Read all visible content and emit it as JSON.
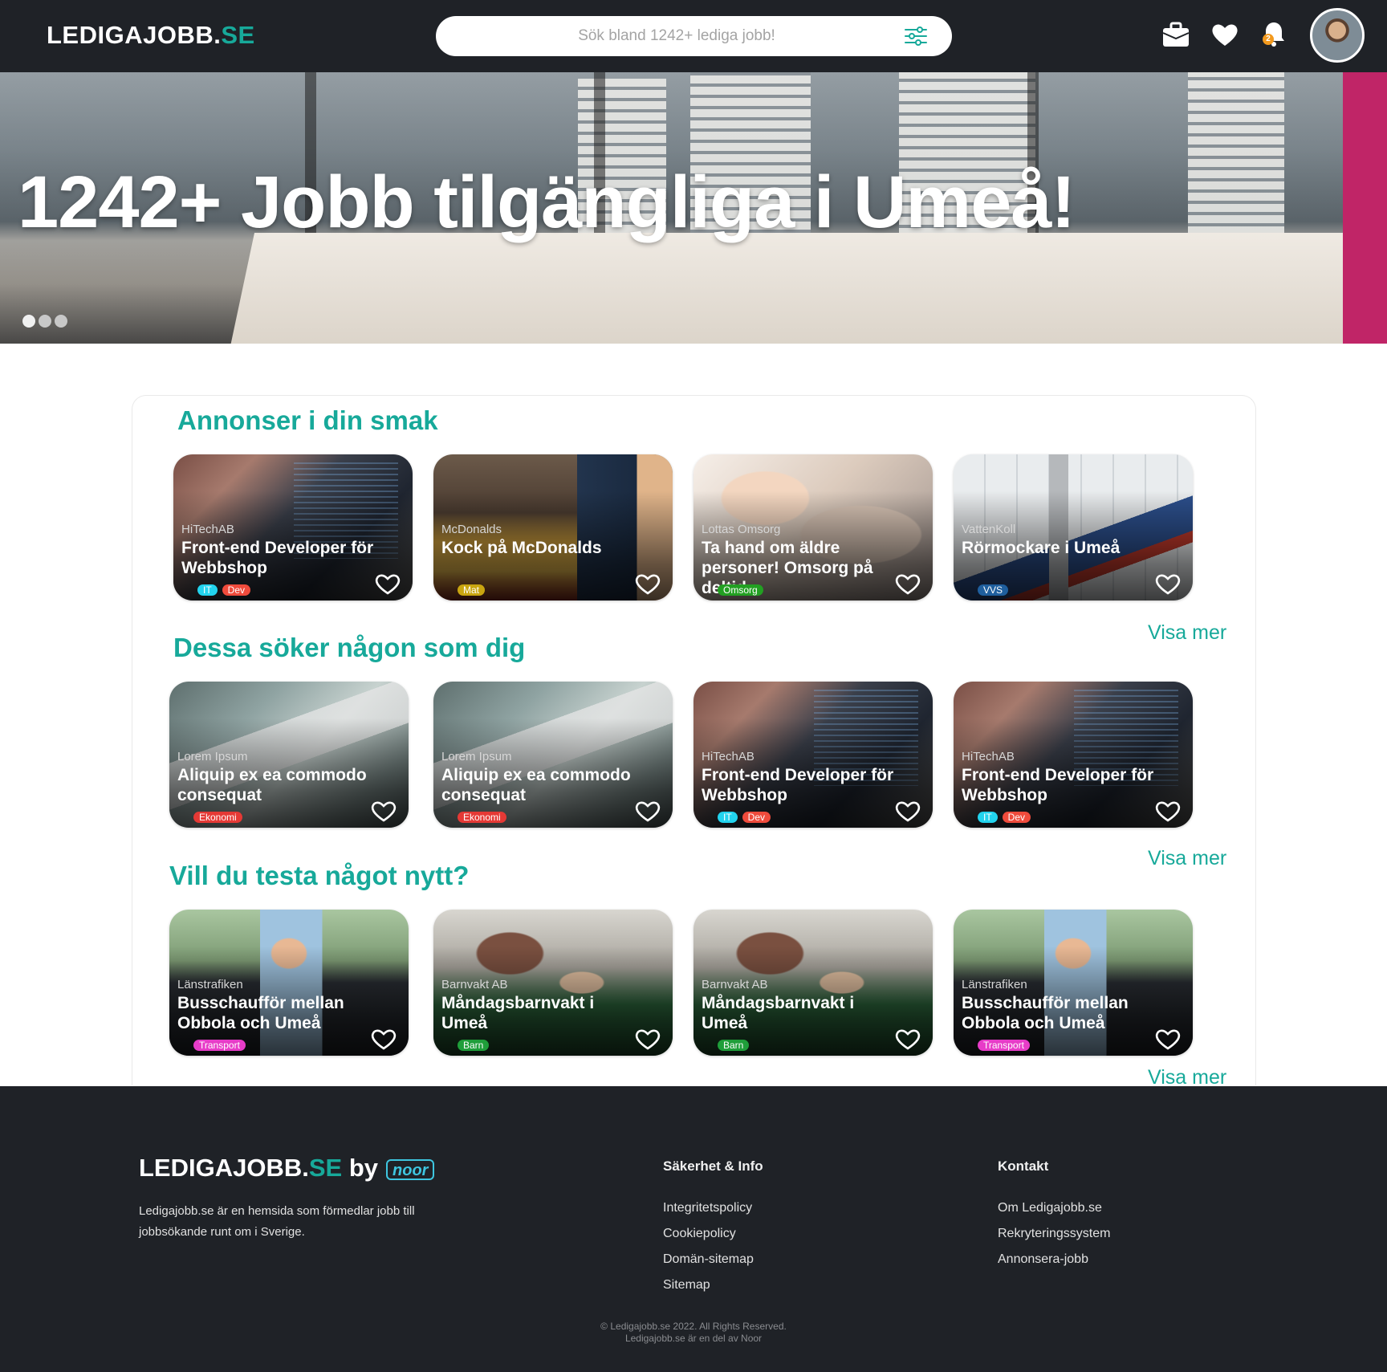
{
  "header": {
    "logo_main": "LEDIGAJOBB.",
    "logo_accent": "SE",
    "search_placeholder": "Sök bland 1242+ lediga jobb!",
    "notification_count": "2"
  },
  "hero": {
    "headline": "1242+ Jobb tilgängliga i Umeå!",
    "slides": 3,
    "active_slide": 1
  },
  "sections": [
    {
      "title": "Annonser i din smak",
      "more": "Visa mer",
      "cards": [
        {
          "company": "HiTechAB",
          "title": "Front-end Developer för Webbshop",
          "image": "code",
          "tags": [
            {
              "label": "IT",
              "color": "#22d3ee"
            },
            {
              "label": "Dev",
              "color": "#ef4b3c"
            }
          ]
        },
        {
          "company": "McDonalds",
          "title": "Kock på McDonalds",
          "image": "food",
          "tags": [
            {
              "label": "Mat",
              "color": "#c9a510"
            }
          ]
        },
        {
          "company": "Lottas Omsorg",
          "title": "Ta hand om äldre personer! Omsorg på deltid.",
          "image": "care",
          "tags": [
            {
              "label": "Omsorg",
              "color": "#22a022"
            }
          ]
        },
        {
          "company": "VattenKoll",
          "title": "Rörmockare i Umeå",
          "image": "pipe",
          "tags": [
            {
              "label": "VVS",
              "color": "#1f5f9e"
            }
          ]
        }
      ]
    },
    {
      "title": "Dessa söker någon som dig",
      "more": "Visa mer",
      "cards": [
        {
          "company": "Lorem Ipsum",
          "title": "Aliquip ex ea commodo consequat",
          "image": "laptop",
          "tags": [
            {
              "label": "Ekonomi",
              "color": "#e53935"
            }
          ]
        },
        {
          "company": "Lorem Ipsum",
          "title": "Aliquip ex ea commodo consequat",
          "image": "laptop",
          "tags": [
            {
              "label": "Ekonomi",
              "color": "#e53935"
            }
          ]
        },
        {
          "company": "HiTechAB",
          "title": "Front-end Developer för Webbshop",
          "image": "code",
          "tags": [
            {
              "label": "IT",
              "color": "#22d3ee"
            },
            {
              "label": "Dev",
              "color": "#ef4b3c"
            }
          ]
        },
        {
          "company": "HiTechAB",
          "title": "Front-end Developer för Webbshop",
          "image": "code",
          "tags": [
            {
              "label": "IT",
              "color": "#22d3ee"
            },
            {
              "label": "Dev",
              "color": "#ef4b3c"
            }
          ]
        }
      ]
    },
    {
      "title": "Vill du testa något nytt?",
      "more": "Visa mer",
      "cards": [
        {
          "company": "Länstrafiken",
          "title": "Busschaufför mellan Obbola och Umeå",
          "image": "bus",
          "tags": [
            {
              "label": "Transport",
              "color": "#e73cc8"
            }
          ]
        },
        {
          "company": "Barnvakt AB",
          "title": "Måndagsbarnvakt i Umeå",
          "image": "baby",
          "tags": [
            {
              "label": "Barn",
              "color": "#1f9e3a"
            }
          ]
        },
        {
          "company": "Barnvakt AB",
          "title": "Måndagsbarnvakt i Umeå",
          "image": "baby",
          "tags": [
            {
              "label": "Barn",
              "color": "#1f9e3a"
            }
          ]
        },
        {
          "company": "Länstrafiken",
          "title": "Busschaufför mellan Obbola och Umeå",
          "image": "bus",
          "tags": [
            {
              "label": "Transport",
              "color": "#e73cc8"
            }
          ]
        }
      ]
    }
  ],
  "footer": {
    "logo_main": "LEDIGAJOBB.",
    "logo_accent": "SE",
    "logo_by": " by",
    "partner": "noor",
    "description": "Ledigajobb.se är en hemsida som förmedlar jobb till jobbsökande runt om i Sverige.",
    "col1_heading": "Säkerhet & Info",
    "col1_links": [
      "Integritetspolicy",
      "Cookiepolicy",
      "Domän-sitemap",
      "Sitemap"
    ],
    "col2_heading": "Kontakt",
    "col2_links": [
      "Om Ledigajobb.se",
      "Rekryteringssystem",
      "Annonsera-jobb"
    ],
    "copyright": "© Ledigajobb.se 2022. All Rights Reserved.",
    "sub_copyright": "Ledigajobb.se är en del av Noor"
  },
  "colors": {
    "accent": "#17a99a",
    "header_bg": "#1f2227",
    "badge": "#f39a1e"
  },
  "icons": [
    "filter-icon",
    "briefcase-icon",
    "heart-icon",
    "bell-icon",
    "avatar"
  ]
}
